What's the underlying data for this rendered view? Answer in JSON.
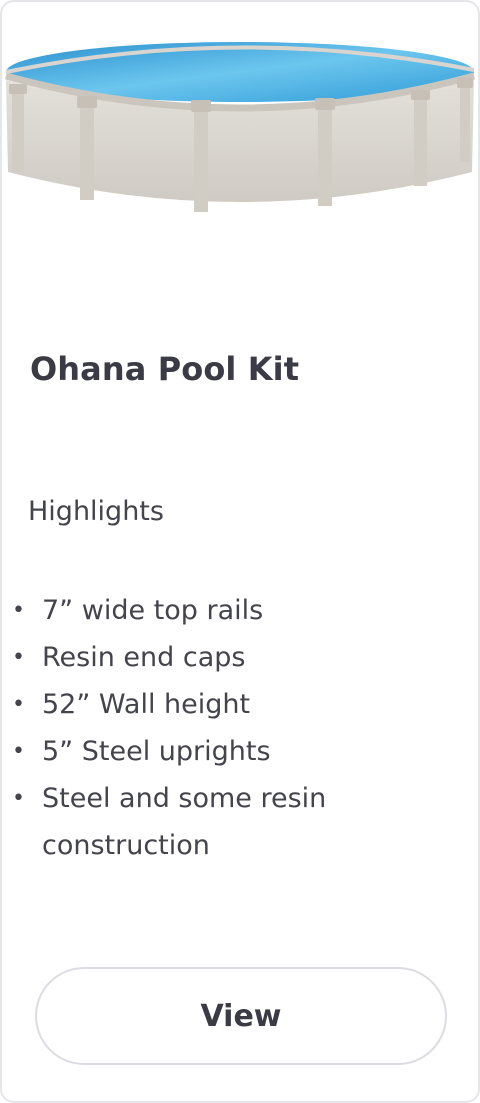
{
  "product": {
    "title": "Ohana Pool Kit",
    "highlights_label": "Highlights",
    "features": [
      "7” wide top rails",
      "Resin end caps",
      "52” Wall height",
      "5” Steel uprights",
      "Steel and some resin construction"
    ],
    "view_label": "View"
  },
  "colors": {
    "card_border": "#e6e6ea",
    "text": "#3b3b45",
    "water": "#3aa6dc",
    "wall": "#d8d5cf",
    "button_border": "#dcdce2"
  },
  "icons": {
    "bullet": "bullet-dot"
  }
}
